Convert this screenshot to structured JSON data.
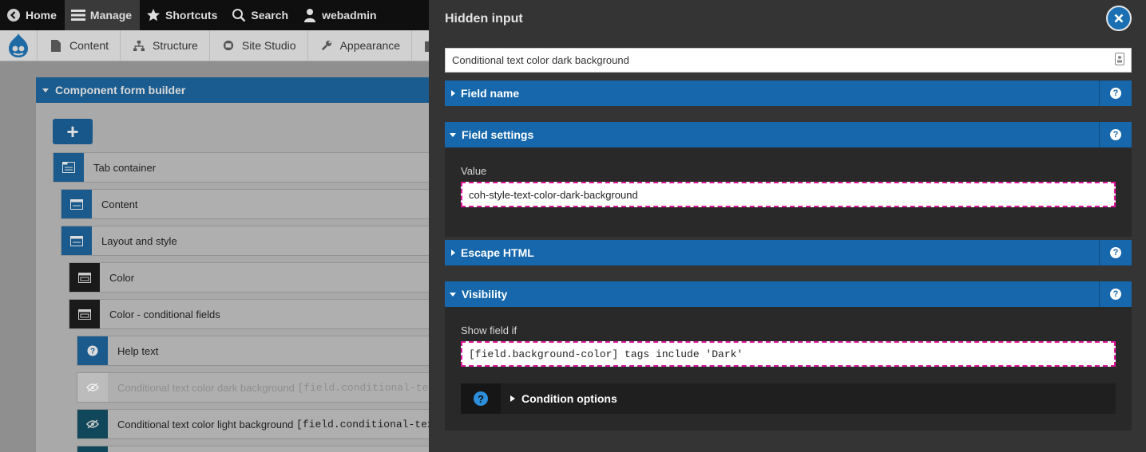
{
  "toolbar": {
    "items": [
      {
        "label": "Home",
        "icon": "chevron-left-circle-icon"
      },
      {
        "label": "Manage",
        "icon": "hamburger-icon"
      },
      {
        "label": "Shortcuts",
        "icon": "star-icon"
      },
      {
        "label": "Search",
        "icon": "search-icon"
      },
      {
        "label": "webadmin",
        "icon": "user-icon"
      }
    ]
  },
  "tray": {
    "logo_icon": "drupal-icon",
    "items": [
      {
        "label": "Content",
        "icon": "document-icon"
      },
      {
        "label": "Structure",
        "icon": "sitemap-icon"
      },
      {
        "label": "Site Studio",
        "icon": "site-studio-icon"
      },
      {
        "label": "Appearance",
        "icon": "wrench-icon"
      }
    ]
  },
  "builder": {
    "title": "Component form builder",
    "add_label": "+",
    "rows": [
      {
        "label": "Tab container",
        "icon": "tab-container-icon"
      },
      {
        "label": "Content",
        "icon": "tab-item-icon"
      },
      {
        "label": "Layout and style",
        "icon": "tab-item-icon"
      },
      {
        "label": "Color",
        "icon": "group-icon"
      },
      {
        "label": "Color - conditional fields",
        "icon": "group-icon"
      },
      {
        "label": "Help text",
        "icon": "help-icon"
      },
      {
        "label": "Conditional text color dark background",
        "code": "[field.conditional-text",
        "icon": "hidden-eye-icon"
      },
      {
        "label": "Conditional text color light background",
        "code": "[field.conditional-text",
        "icon": "hidden-eye-icon"
      }
    ]
  },
  "modal": {
    "title": "Hidden input",
    "title_input_value": "Conditional text color dark background",
    "sections": {
      "field_name": {
        "label": "Field name"
      },
      "field_settings": {
        "label": "Field settings",
        "value_label": "Value",
        "value": "coh-style-text-color-dark-background"
      },
      "escape_html": {
        "label": "Escape HTML"
      },
      "visibility": {
        "label": "Visibility",
        "show_field_label": "Show field if",
        "show_field_value": "[field.background-color] tags include 'Dark'",
        "condition_options_label": "Condition options"
      }
    }
  },
  "colors": {
    "accent_blue": "#1667ab",
    "dashed_highlight": "#e0149c",
    "modal_bg": "#343434"
  }
}
